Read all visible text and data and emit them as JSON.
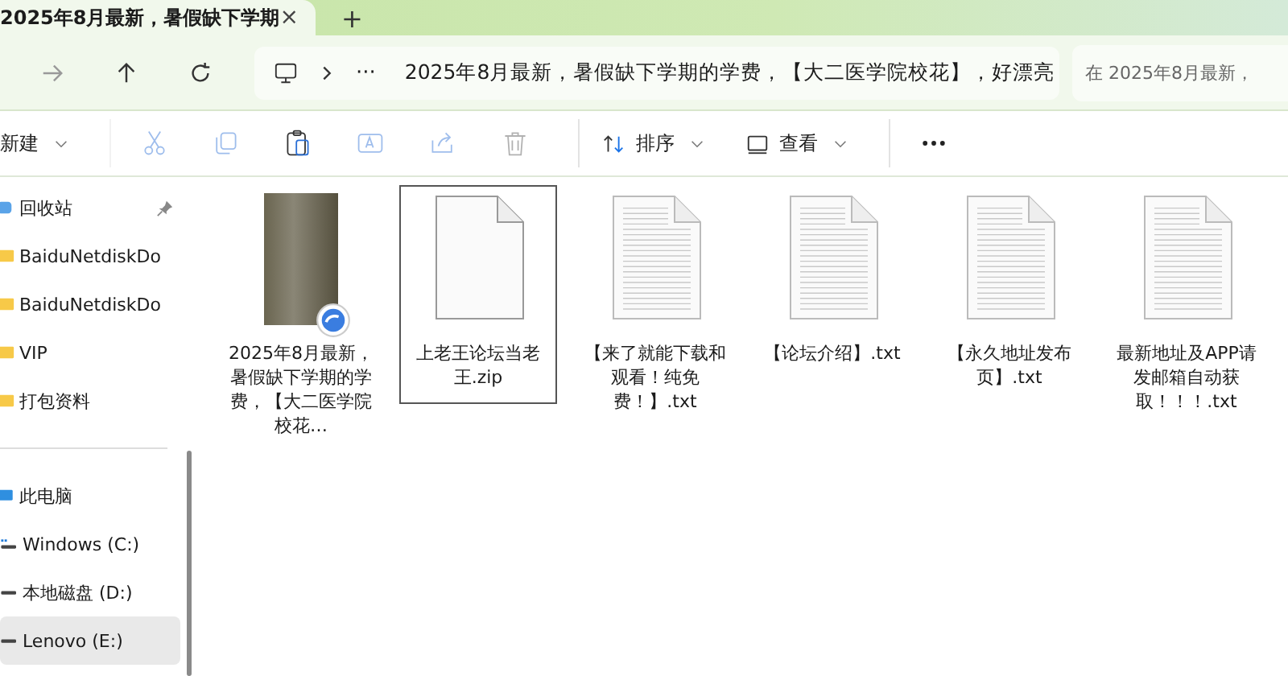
{
  "tab": {
    "title": "2025年8月最新，暑假缺下学期",
    "close": "×",
    "new": "+"
  },
  "address": {
    "ellipsis": "···",
    "path": "2025年8月最新，暑假缺下学期的学费，【大二医学院校花】，好漂亮"
  },
  "search": {
    "placeholder": "在 2025年8月最新，"
  },
  "commands": [
    {
      "kind": "new",
      "label": "新建"
    },
    {
      "kind": "cut",
      "disabled": true
    },
    {
      "kind": "copy",
      "disabled": true
    },
    {
      "kind": "paste",
      "disabled": false
    },
    {
      "kind": "rename",
      "disabled": true
    },
    {
      "kind": "share",
      "disabled": true
    },
    {
      "kind": "delete",
      "disabled": true
    },
    {
      "kind": "sort",
      "label": "排序"
    },
    {
      "kind": "view",
      "label": "查看"
    },
    {
      "kind": "more",
      "disabled": false
    }
  ],
  "sidebar": {
    "items": [
      {
        "kind": "recycle",
        "label": "回收站",
        "pinned": true,
        "selected": false
      },
      {
        "kind": "folder",
        "label": "BaiduNetdiskDo",
        "pinned": false,
        "selected": false
      },
      {
        "kind": "folder",
        "label": "BaiduNetdiskDo",
        "pinned": false,
        "selected": false
      },
      {
        "kind": "folder",
        "label": "VIP",
        "pinned": false,
        "selected": false
      },
      {
        "kind": "folder",
        "label": "打包资料",
        "pinned": false,
        "selected": false
      },
      {
        "kind": "divider"
      },
      {
        "kind": "pc",
        "label": "此电脑",
        "pinned": false,
        "selected": false
      },
      {
        "kind": "windrive",
        "label": "Windows (C:)",
        "pinned": false,
        "selected": false
      },
      {
        "kind": "drive",
        "label": "本地磁盘 (D:)",
        "pinned": false,
        "selected": false
      },
      {
        "kind": "drive",
        "label": "Lenovo (E:)",
        "pinned": false,
        "selected": true
      }
    ]
  },
  "files": [
    {
      "kind": "video",
      "name": "2025年8月最新，暑假缺下学期的学费，【大二医学院校花…",
      "selected": false
    },
    {
      "kind": "zip",
      "name": "上老王论坛当老王.zip",
      "selected": true
    },
    {
      "kind": "txt",
      "name": "【来了就能下载和观看！纯免费！】.txt",
      "selected": false
    },
    {
      "kind": "txt",
      "name": "【论坛介绍】.txt",
      "selected": false
    },
    {
      "kind": "txt",
      "name": "【永久地址发布页】.txt",
      "selected": false
    },
    {
      "kind": "txt",
      "name": "最新地址及APP请发邮箱自动获取！！！.txt",
      "selected": false
    }
  ]
}
